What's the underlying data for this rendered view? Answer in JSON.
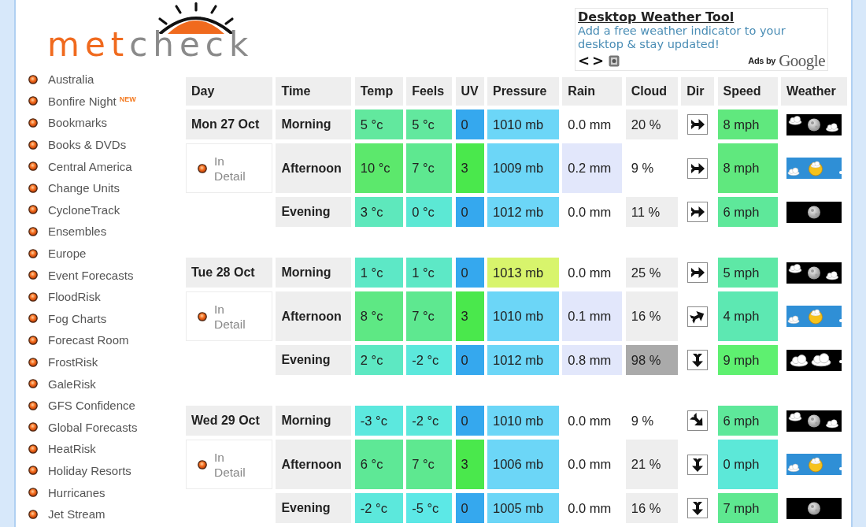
{
  "header": {
    "logo": {
      "parts": [
        "met",
        "check"
      ]
    },
    "ad": {
      "title": "Desktop Weather Tool",
      "text": "Add a free weather indicator to your desktop & stay updated!",
      "nav": [
        "<",
        ">"
      ],
      "attribution": "Ads by",
      "brand": "Google"
    }
  },
  "sidebar": {
    "items": [
      {
        "label": "Australia"
      },
      {
        "label": "Bonfire Night",
        "badge": "NEW"
      },
      {
        "label": "Bookmarks"
      },
      {
        "label": "Books & DVDs"
      },
      {
        "label": "Central America"
      },
      {
        "label": "Change Units"
      },
      {
        "label": "CycloneTrack"
      },
      {
        "label": "Ensembles"
      },
      {
        "label": "Europe"
      },
      {
        "label": "Event Forecasts"
      },
      {
        "label": "FloodRisk"
      },
      {
        "label": "Fog Charts"
      },
      {
        "label": "Forecast Room"
      },
      {
        "label": "FrostRisk"
      },
      {
        "label": "GaleRisk"
      },
      {
        "label": "GFS Confidence"
      },
      {
        "label": "Global Forecasts"
      },
      {
        "label": "HeatRisk"
      },
      {
        "label": "Holiday Resorts"
      },
      {
        "label": "Hurricanes"
      },
      {
        "label": "Jet Stream"
      }
    ]
  },
  "forecast": {
    "columns": [
      "Day",
      "Time",
      "Temp",
      "Feels",
      "UV",
      "Pressure",
      "Rain",
      "Cloud",
      "Dir",
      "Speed",
      "Weather"
    ],
    "days": [
      {
        "day": "Mon 27 Oct",
        "link": "In Detail",
        "rows": [
          {
            "time": "Morning",
            "temp": {
              "text": "5 °c",
              "color": "#62e89e"
            },
            "feels": {
              "text": "5 °c",
              "color": "#62e89e"
            },
            "uv": {
              "text": "0",
              "color": "#35a8ee"
            },
            "pressure": {
              "text": "1010 mb",
              "color": "#6cd6f7"
            },
            "rain": {
              "text": "0.0 mm",
              "color": "#ffffff"
            },
            "cloud": {
              "text": "20 %",
              "color": "#eeeeee"
            },
            "dir": {
              "kind": "right"
            },
            "speed": {
              "text": "8 mph",
              "color": "#60e87e"
            },
            "weather": {
              "kind": "moon-clouds"
            }
          },
          {
            "time": "Afternoon",
            "temp": {
              "text": "10 °c",
              "color": "#5ce86c"
            },
            "feels": {
              "text": "7 °c",
              "color": "#5ee890"
            },
            "uv": {
              "text": "3",
              "color": "#4ae84c"
            },
            "pressure": {
              "text": "1009 mb",
              "color": "#6cd6f7"
            },
            "rain": {
              "text": "0.2 mm",
              "color": "#e2e7fb"
            },
            "cloud": {
              "text": "9 %",
              "color": "#ffffff"
            },
            "dir": {
              "kind": "right"
            },
            "speed": {
              "text": "8 mph",
              "color": "#60e87e"
            },
            "weather": {
              "kind": "sun-cloud"
            }
          },
          {
            "time": "Evening",
            "temp": {
              "text": "3 °c",
              "color": "#5ee8bc"
            },
            "feels": {
              "text": "0 °c",
              "color": "#5ce8d4"
            },
            "uv": {
              "text": "0",
              "color": "#35a8ee"
            },
            "pressure": {
              "text": "1012 mb",
              "color": "#6cd6f7"
            },
            "rain": {
              "text": "0.0 mm",
              "color": "#ffffff"
            },
            "cloud": {
              "text": "11 %",
              "color": "#eeeeee"
            },
            "dir": {
              "kind": "right"
            },
            "speed": {
              "text": "6 mph",
              "color": "#5ee89a"
            },
            "weather": {
              "kind": "moon"
            }
          }
        ]
      },
      {
        "day": "Tue 28 Oct",
        "link": "In Detail",
        "rows": [
          {
            "time": "Morning",
            "temp": {
              "text": "1 °c",
              "color": "#5de8c6"
            },
            "feels": {
              "text": "1 °c",
              "color": "#5de8c6"
            },
            "uv": {
              "text": "0",
              "color": "#35a8ee"
            },
            "pressure": {
              "text": "1013 mb",
              "color": "#d8f46c"
            },
            "rain": {
              "text": "0.0 mm",
              "color": "#ffffff"
            },
            "cloud": {
              "text": "25 %",
              "color": "#eeeeee"
            },
            "dir": {
              "kind": "right"
            },
            "speed": {
              "text": "5 mph",
              "color": "#5ee8a6"
            },
            "weather": {
              "kind": "moon-clouds"
            }
          },
          {
            "time": "Afternoon",
            "temp": {
              "text": "8 °c",
              "color": "#5ee884"
            },
            "feels": {
              "text": "7 °c",
              "color": "#5ee890"
            },
            "uv": {
              "text": "3",
              "color": "#4ae84c"
            },
            "pressure": {
              "text": "1010 mb",
              "color": "#6cd6f7"
            },
            "rain": {
              "text": "0.1 mm",
              "color": "#e2e7fb"
            },
            "cloud": {
              "text": "16 %",
              "color": "#eeeeee"
            },
            "dir": {
              "kind": "up-right"
            },
            "speed": {
              "text": "4 mph",
              "color": "#5de8b2"
            },
            "weather": {
              "kind": "sun-cloud"
            }
          },
          {
            "time": "Evening",
            "temp": {
              "text": "2 °c",
              "color": "#5de8c2"
            },
            "feels": {
              "text": "-2 °c",
              "color": "#5ce8dc"
            },
            "uv": {
              "text": "0",
              "color": "#35a8ee"
            },
            "pressure": {
              "text": "1012 mb",
              "color": "#6cd6f7"
            },
            "rain": {
              "text": "0.8 mm",
              "color": "#e2e7fb"
            },
            "cloud": {
              "text": "98 %",
              "color": "#aaaaaa"
            },
            "dir": {
              "kind": "down"
            },
            "speed": {
              "text": "9 mph",
              "color": "#5ef070"
            },
            "weather": {
              "kind": "clouds"
            }
          }
        ]
      },
      {
        "day": "Wed 29 Oct",
        "link": "In Detail",
        "rows": [
          {
            "time": "Morning",
            "temp": {
              "text": "-3 °c",
              "color": "#5ce8de"
            },
            "feels": {
              "text": "-2 °c",
              "color": "#5ce8dc"
            },
            "uv": {
              "text": "0",
              "color": "#35a8ee"
            },
            "pressure": {
              "text": "1010 mb",
              "color": "#6cd6f7"
            },
            "rain": {
              "text": "0.0 mm",
              "color": "#ffffff"
            },
            "cloud": {
              "text": "9 %",
              "color": "#ffffff"
            },
            "dir": {
              "kind": "down-right"
            },
            "speed": {
              "text": "6 mph",
              "color": "#5ee89a"
            },
            "weather": {
              "kind": "moon-clouds"
            }
          },
          {
            "time": "Afternoon",
            "temp": {
              "text": "6 °c",
              "color": "#5ee896"
            },
            "feels": {
              "text": "7 °c",
              "color": "#5ee890"
            },
            "uv": {
              "text": "3",
              "color": "#4ae84c"
            },
            "pressure": {
              "text": "1006 mb",
              "color": "#6cd6f7"
            },
            "rain": {
              "text": "0.0 mm",
              "color": "#ffffff"
            },
            "cloud": {
              "text": "21 %",
              "color": "#eeeeee"
            },
            "dir": {
              "kind": "down"
            },
            "speed": {
              "text": "0 mph",
              "color": "#5ce8d8"
            },
            "weather": {
              "kind": "sun-cloud"
            }
          },
          {
            "time": "Evening",
            "temp": {
              "text": "-2 °c",
              "color": "#5ce8dc"
            },
            "feels": {
              "text": "-5 °c",
              "color": "#5ce8e6"
            },
            "uv": {
              "text": "0",
              "color": "#35a8ee"
            },
            "pressure": {
              "text": "1005 mb",
              "color": "#6cd6f7"
            },
            "rain": {
              "text": "0.0 mm",
              "color": "#ffffff"
            },
            "cloud": {
              "text": "16 %",
              "color": "#eeeeee"
            },
            "dir": {
              "kind": "down"
            },
            "speed": {
              "text": "7 mph",
              "color": "#5ee890"
            },
            "weather": {
              "kind": "moon"
            }
          }
        ]
      }
    ]
  }
}
